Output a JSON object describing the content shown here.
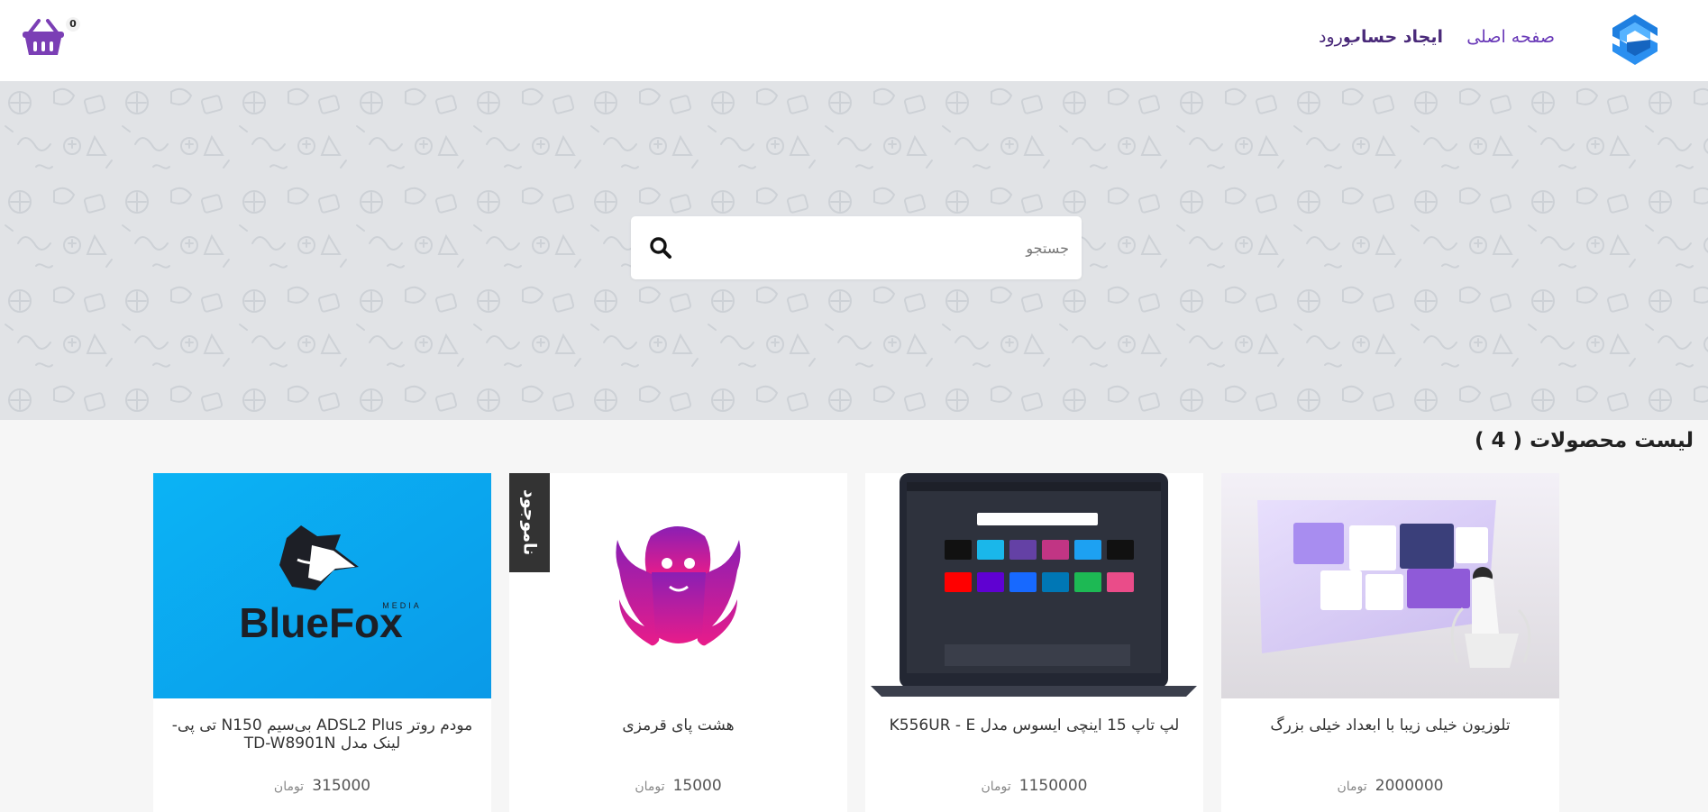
{
  "header": {
    "nav": {
      "home": "صفحه اصلی",
      "register": "ایجاد حساب",
      "login": "ورود"
    },
    "cart_count": "0"
  },
  "search": {
    "placeholder": "جستجو"
  },
  "products": {
    "title": "لیست محصولات ( 4 )",
    "items": [
      {
        "name": "تلوزیون خیلی زیبا با ابعداد خیلی بزرگ",
        "price": "2000000",
        "currency": "تومان"
      },
      {
        "name": "لپ تاپ 15 اینچی ایسوس مدل K556UR - E",
        "price": "1150000",
        "currency": "تومان"
      },
      {
        "name": "هشت پای قرمزی",
        "price": "15000",
        "currency": "تومان",
        "badge": "ناموجود"
      },
      {
        "name": "مودم روتر ADSL2 Plus بی‌سیم N150 تی پی-لینک مدل TD-W8901N",
        "price": "315000",
        "currency": "تومان",
        "logo_text": "BlueFox",
        "logo_sub": "MEDIA"
      }
    ]
  },
  "colors": {
    "accent": "#6a3ab8",
    "cart": "#7b3fb5",
    "logo": "#1e7fe0"
  }
}
